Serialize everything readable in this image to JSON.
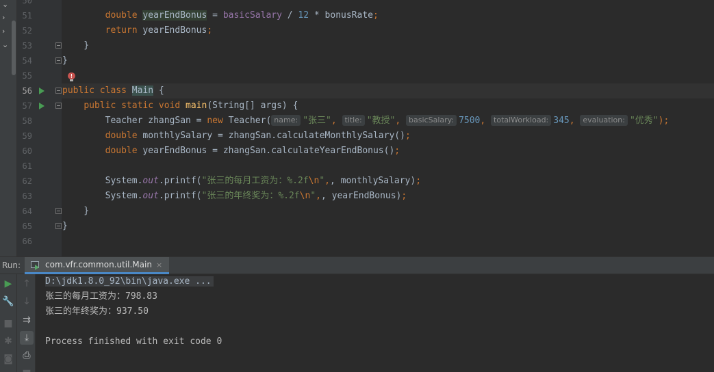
{
  "editor": {
    "lines": [
      {
        "no": "50",
        "code": ""
      },
      {
        "no": "51",
        "code": "        double yearEndBonus = basicSalary / 12 * bonusRate;"
      },
      {
        "no": "52",
        "code": "        return yearEndBonus;"
      },
      {
        "no": "53",
        "code": "    }"
      },
      {
        "no": "54",
        "code": "}"
      },
      {
        "no": "55",
        "code": ""
      },
      {
        "no": "56",
        "code": "public class Main {"
      },
      {
        "no": "57",
        "code": "    public static void main(String[] args) {"
      },
      {
        "no": "58",
        "code": "        Teacher zhangSan = new Teacher( name: \"张三\",  title: \"教授\",  basicSalary: 7500,  totalWorkload: 345,  evaluation: \"优秀\");"
      },
      {
        "no": "59",
        "code": "        double monthlySalary = zhangSan.calculateMonthlySalary();"
      },
      {
        "no": "60",
        "code": "        double yearEndBonus = zhangSan.calculateYearEndBonus();"
      },
      {
        "no": "61",
        "code": ""
      },
      {
        "no": "62",
        "code": "        System.out.printf(\"张三的每月工资为：%.2f\\n\", monthlySalary);"
      },
      {
        "no": "63",
        "code": "        System.out.printf(\"张三的年终奖为：%.2f\\n\", yearEndBonus);"
      },
      {
        "no": "64",
        "code": "    }"
      },
      {
        "no": "65",
        "code": "}"
      },
      {
        "no": "66",
        "code": ""
      }
    ],
    "parts": {
      "l51": {
        "kw": "double",
        "var": "yearEndBonus",
        "eq": " = ",
        "fld1": "basicSalary",
        "op": " / ",
        "num": "12",
        "op2": " * ",
        "v2": "bonusRate",
        "semi": ";"
      },
      "l52": {
        "kw": "return",
        "rest": " yearEndBonus",
        "semi": ";"
      },
      "l56": {
        "kw1": "public",
        "kw2": "class",
        "cls": "Main",
        "brace": " {"
      },
      "l57": {
        "kw1": "public",
        "kw2": "static",
        "kw3": "void",
        "mth": "main",
        "rest": "(String[] args) {"
      },
      "l58": {
        "pre": "Teacher zhangSan = ",
        "kw": "new",
        "call": " Teacher(",
        "h1": "name:",
        "s1": "\"张三\"",
        "c1": ",",
        "h2": "title:",
        "s2": "\"教授\"",
        "c2": ",",
        "h3": "basicSalary:",
        "n3": "7500",
        "c3": ",",
        "h4": "totalWorkload:",
        "n4": "345",
        "c4": ",",
        "h5": "evaluation:",
        "s5": "\"优秀\"",
        "end": ");"
      },
      "l59": {
        "kw": "double",
        "rest": " monthlySalary = zhangSan.calculateMonthlySalary()",
        "semi": ";"
      },
      "l60": {
        "kw": "double",
        "rest": " yearEndBonus = zhangSan.calculateYearEndBonus()",
        "semi": ";"
      },
      "l62": {
        "sys": "System.",
        "out": "out",
        "pf": ".printf(",
        "s1": "\"张三的每月工资为：%.2f",
        "esc": "\\n",
        "s2": "\"",
        "rest": ", monthlySalary)",
        "semi": ";"
      },
      "l63": {
        "sys": "System.",
        "out": "out",
        "pf": ".printf(",
        "s1": "\"张三的年终奖为：%.2f",
        "esc": "\\n",
        "s2": "\"",
        "rest": ", yearEndBonus)",
        "semi": ";"
      }
    }
  },
  "run_panel": {
    "label": "Run:",
    "tab": {
      "title": "com.vfr.common.util.Main",
      "close": "×"
    },
    "console": [
      "D:\\jdk1.8.0_92\\bin\\java.exe ...",
      "张三的每月工资为：798.83",
      "张三的年终奖为：937.50",
      "",
      "Process finished with exit code 0"
    ]
  },
  "icons": {
    "rerun": "play-icon",
    "settings": "wrench-icon",
    "stop": "stop-icon",
    "up": "arrow-up-icon",
    "down": "arrow-down-icon",
    "wrap": "soft-wrap-icon",
    "scroll_end": "scroll-to-end-icon",
    "print": "print-icon",
    "camera": "camera-icon",
    "debug": "bug-icon",
    "trash": "trash-icon",
    "bulb": "error-bulb-icon"
  },
  "colors": {
    "keyword": "#cc7832",
    "string": "#6a8759",
    "number": "#6897bb",
    "field": "#9876aa",
    "method": "#ffc66d",
    "run_green": "#499c54"
  }
}
